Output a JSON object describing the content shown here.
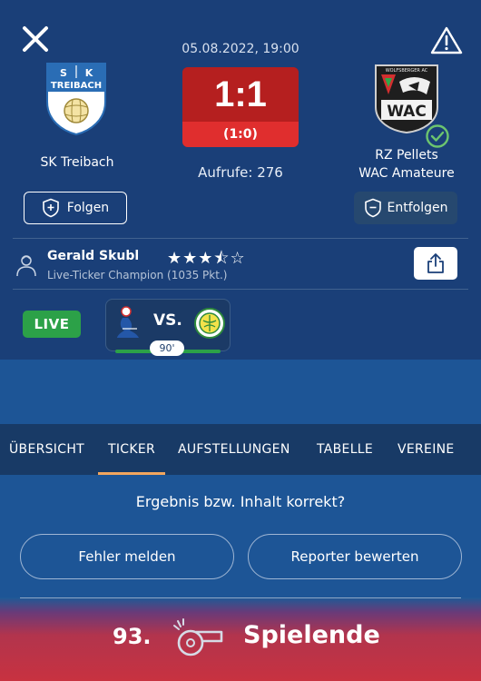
{
  "match": {
    "datetime": "05.08.2022, 19:00",
    "score": "1:1",
    "halftime": "(1:0)",
    "views_label": "Aufrufe: 276",
    "home_team": "SK Treibach",
    "away_team_line1": "RZ Pellets",
    "away_team_line2": "WAC Amateure",
    "home_crest_text": {
      "top_left": "S",
      "top_right": "K",
      "name": "TREIBACH"
    },
    "away_crest_text": {
      "arc": "WOLFSBERGER AC",
      "name": "WAC"
    }
  },
  "actions": {
    "follow": "Folgen",
    "unfollow": "Entfolgen"
  },
  "reporter": {
    "name": "Gerald Skubl",
    "rating_stars": 3.5,
    "stars_display": "★★★⯪☆",
    "subtitle": "Live-Ticker Champion (1035 Pkt.)"
  },
  "live_badge": "LIVE",
  "mini_match": {
    "vs": "VS.",
    "minute": "90'",
    "progress": 1.0
  },
  "tabs": [
    {
      "label": "ÜBERSICHT",
      "active": false
    },
    {
      "label": "TICKER",
      "active": true
    },
    {
      "label": "AUFSTELLUNGEN",
      "active": false
    },
    {
      "label": "TABELLE",
      "active": false
    },
    {
      "label": "VEREINE",
      "active": false
    }
  ],
  "feedback": {
    "question": "Ergebnis bzw. Inhalt korrekt?",
    "report_error": "Fehler melden",
    "rate_reporter": "Reporter bewerten"
  },
  "event": {
    "minute": "93.",
    "label": "Spielende",
    "icon": "whistle-icon"
  },
  "colors": {
    "header_bg": "#1a3f78",
    "page_bg": "#1d5596",
    "score_red": "#b51f1f",
    "live_green": "#2ca148",
    "tab_accent": "#f2a65e"
  }
}
